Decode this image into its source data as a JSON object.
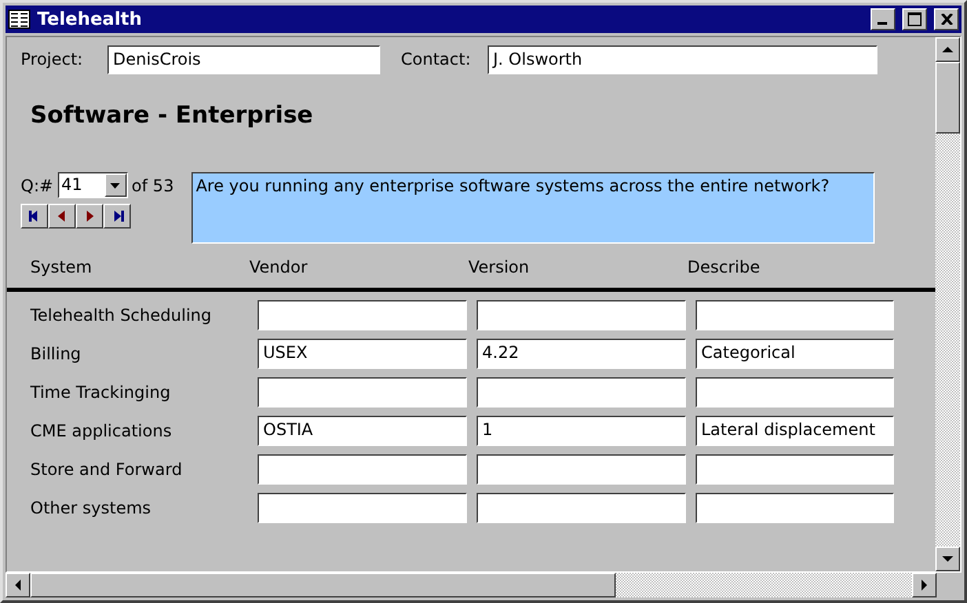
{
  "window": {
    "title": "Telehealth"
  },
  "project": {
    "label": "Project:",
    "value": "DenisCrois"
  },
  "contact": {
    "label": "Contact:",
    "value": "J. Olsworth"
  },
  "heading": "Software - Enterprise",
  "question": {
    "label": "Q:#",
    "number": "41",
    "total": "of 53",
    "text": "Are you running any enterprise software systems across the entire network?"
  },
  "table": {
    "columns": [
      "System",
      "Vendor",
      "Version",
      "Describe"
    ],
    "rows": [
      {
        "system": "Telehealth Scheduling"
      },
      {
        "system": "Billing",
        "vendor": "USEX",
        "version": "4.22",
        "describe": "Categorical"
      },
      {
        "system": "Time Trackinging"
      },
      {
        "system": "CME applications",
        "vendor": "OSTIA",
        "version": "1",
        "describe": "Lateral displacement"
      },
      {
        "system": "Store and Forward"
      },
      {
        "system": "Other systems"
      }
    ]
  }
}
